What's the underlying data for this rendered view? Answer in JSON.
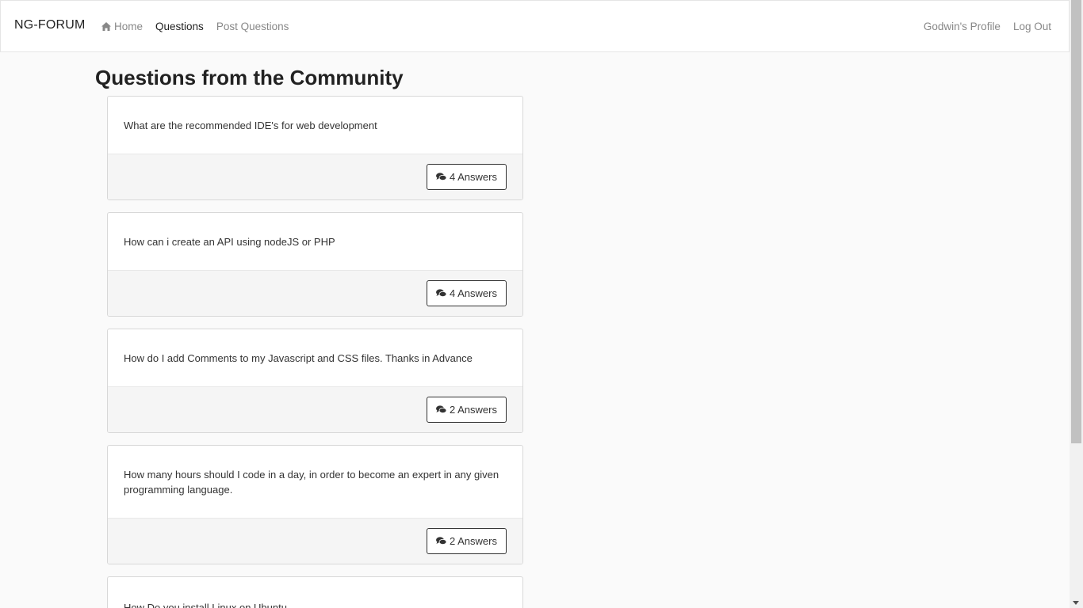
{
  "navbar": {
    "brand": "NG-FORUM",
    "links": [
      {
        "label": "Home",
        "icon": "home-icon",
        "active": false
      },
      {
        "label": "Questions",
        "active": true
      },
      {
        "label": "Post Questions",
        "active": false
      }
    ],
    "right_links": [
      {
        "label": "Godwin's Profile"
      },
      {
        "label": "Log Out"
      }
    ]
  },
  "main": {
    "title": "Questions from the Community",
    "questions": [
      {
        "text": "What are the recommended IDE's for web development",
        "answers_label": "4 Answers"
      },
      {
        "text": "How can i create an API using nodeJS or PHP",
        "answers_label": "4 Answers"
      },
      {
        "text": "How do I add Comments to my Javascript and CSS files. Thanks in Advance",
        "answers_label": "2 Answers"
      },
      {
        "text": "How many hours should I code in a day, in order to become an expert in any given programming language.",
        "answers_label": "2 Answers"
      },
      {
        "text": "How Do you install Linux on Ubuntu",
        "answers_label": ""
      }
    ]
  },
  "colors": {
    "background": "#fafafa",
    "navbar_bg": "#ffffff",
    "muted_link": "#888888",
    "text": "#333333"
  }
}
